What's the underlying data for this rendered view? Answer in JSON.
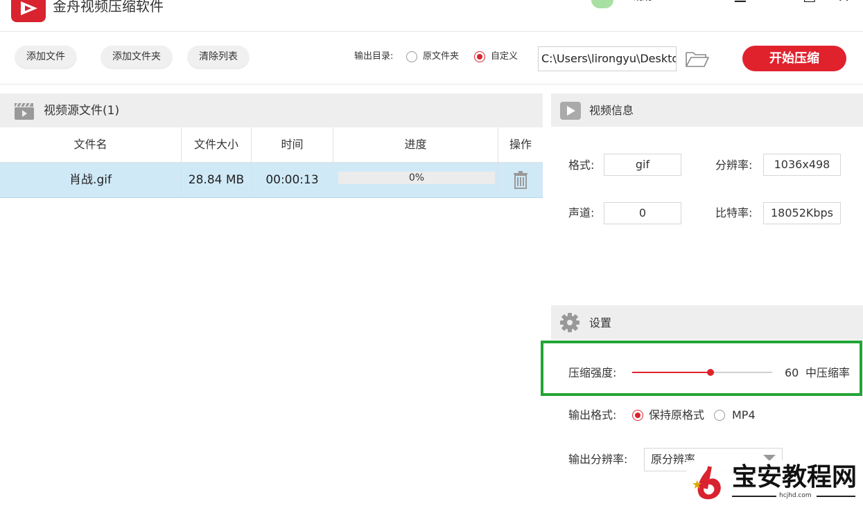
{
  "window": {
    "title": "金舟视频压缩软件",
    "user_name": "观观"
  },
  "toolbar": {
    "add_file": "添加文件",
    "add_folder": "添加文件夹",
    "clear_list": "清除列表",
    "output_dir_label": "输出目录:",
    "option_source_folder": "原文件夹",
    "option_custom": "自定义",
    "selected_output_option": "自定义",
    "output_path": "C:\\Users\\lirongyu\\Desktop",
    "start_button": "开始压缩"
  },
  "source_panel": {
    "title": "视频源文件(1)",
    "columns": [
      "文件名",
      "文件大小",
      "时间",
      "进度",
      "操作"
    ],
    "rows": [
      {
        "name": "肖战.gif",
        "size": "28.84 MB",
        "duration": "00:00:13",
        "progress_text": "0%",
        "progress": 0
      }
    ]
  },
  "info_panel": {
    "title": "视频信息",
    "format_label": "格式:",
    "format_value": "gif",
    "resolution_label": "分辨率:",
    "resolution_value": "1036x498",
    "channel_label": "声道:",
    "channel_value": "0",
    "bitrate_label": "比特率:",
    "bitrate_value": "18052Kbps"
  },
  "settings": {
    "title": "设置",
    "compression_label": "压缩强度:",
    "compression_value": "60",
    "compression_fraction": 0.6,
    "compression_level": "中压缩率",
    "output_format_label": "输出格式:",
    "format_options": [
      "保持原格式",
      "MP4"
    ],
    "selected_format": "保持原格式",
    "output_resolution_label": "输出分辨率:",
    "output_resolution_value": "原分辨率"
  },
  "watermark": {
    "text": "宝安教程网",
    "url": "hcjhd.com"
  },
  "colors": {
    "accent": "#e0222d",
    "selected_row": "#cfe9f7",
    "highlight_box": "#22a535",
    "panel_header": "#eeeeee"
  }
}
